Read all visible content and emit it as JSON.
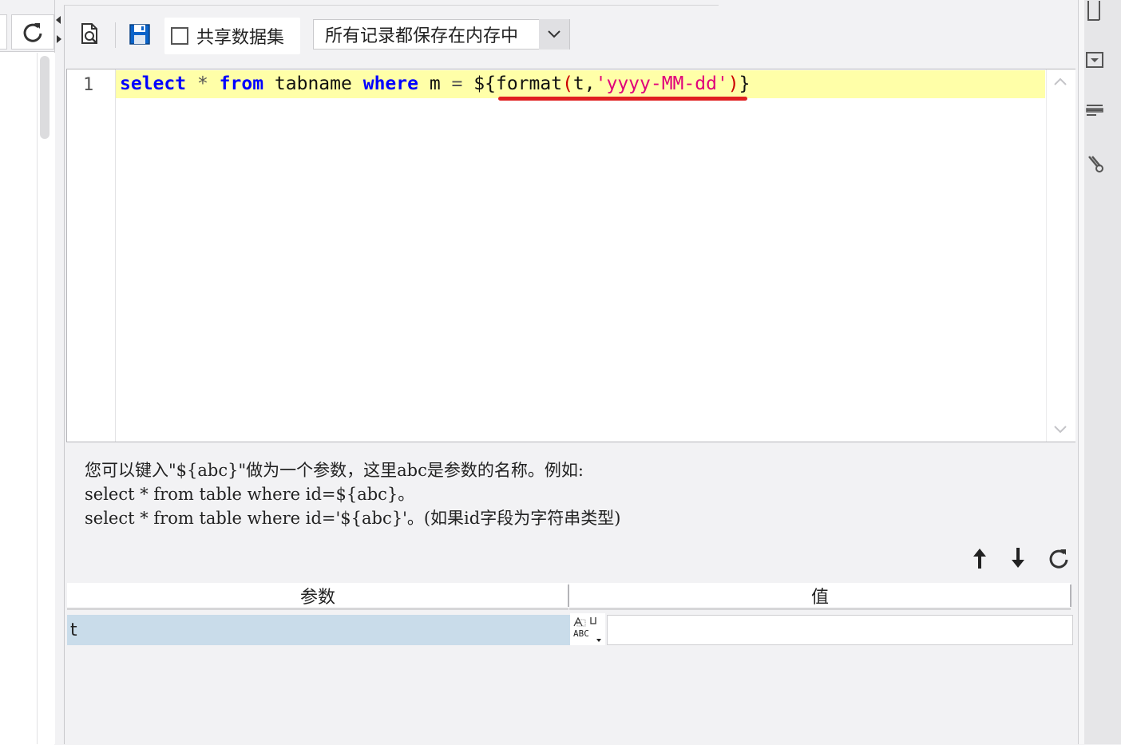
{
  "toolbar": {
    "preview_icon": "preview-icon",
    "save_icon": "save-icon",
    "share_label": "共享数据集",
    "share_checked": false,
    "storage_select": "所有记录都保存在内存中"
  },
  "editor": {
    "line_number": "1",
    "tokens": {
      "kw_select": "select",
      "star": "*",
      "kw_from": "from",
      "table": "tabname",
      "kw_where": "where",
      "col": "m",
      "eq": "=",
      "dollar_open": "${",
      "fn": "format",
      "lparen": "(",
      "arg": "t,",
      "str": "'yyyy-MM-dd'",
      "rparen": ")",
      "close": "}"
    }
  },
  "hint": {
    "line1": "您可以键入\"${abc}\"做为一个参数，这里abc是参数的名称。例如:",
    "line2": "select * from table where id=${abc}。",
    "line3": "select * from table where id='${abc}'。(如果id字段为字符串类型)"
  },
  "params_table": {
    "col_param": "参数",
    "col_value": "值",
    "rows": [
      {
        "name": "t",
        "type_icon": "abc-text-type-icon",
        "value": ""
      }
    ]
  },
  "colors": {
    "keyword": "#0000ff",
    "string": "#e0007a",
    "paren": "#cc0000",
    "highlight_line": "#ffffa8",
    "selected_row": "#c9dcea",
    "annotation": "#e02020"
  }
}
